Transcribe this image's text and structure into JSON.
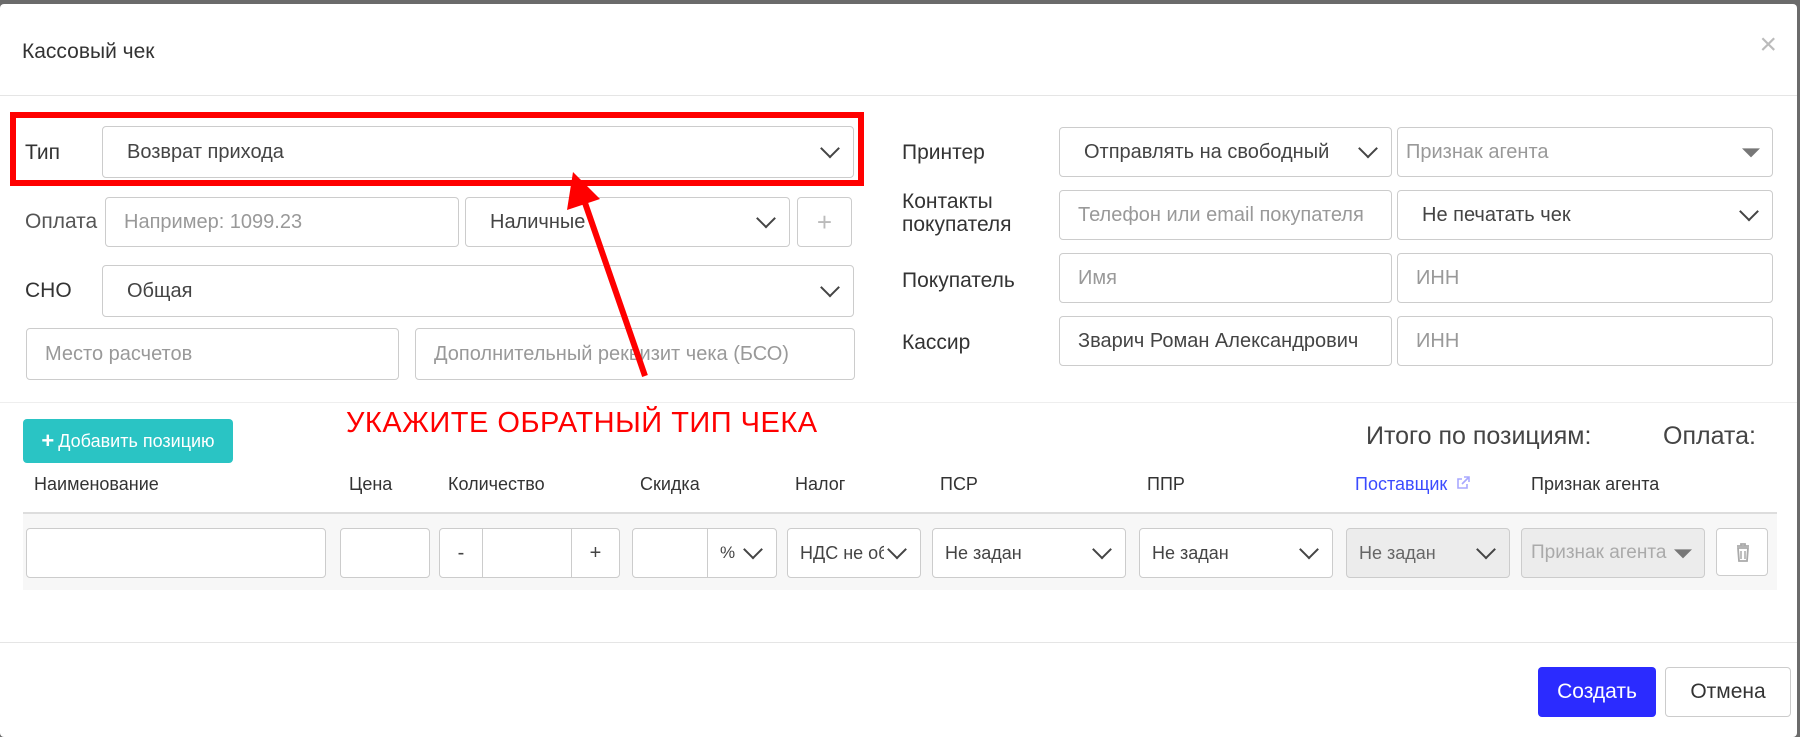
{
  "dialog": {
    "title": "Кассовый чек",
    "close_glyph": "×"
  },
  "form": {
    "type_label": "Тип",
    "type_value": "Возврат прихода",
    "payment_label": "Оплата",
    "payment_placeholder": "Например: 1099.23",
    "payment_method": "Наличные",
    "add_payment_glyph": "+",
    "sno_label": "СНО",
    "sno_value": "Общая",
    "place_placeholder": "Место расчетов",
    "extra_placeholder": "Дополнительный реквизит чека (БСО)",
    "printer_label": "Принтер",
    "printer_value": "Отправлять на свободный",
    "agent_placeholder": "Признак агента",
    "contacts_label_1": "Контакты",
    "contacts_label_2": "покупателя",
    "contacts_placeholder": "Телефон или email покупателя",
    "print_mode": "Не печатать чек",
    "buyer_label": "Покупатель",
    "buyer_name_placeholder": "Имя",
    "buyer_inn_placeholder": "ИНН",
    "cashier_label": "Кассир",
    "cashier_value": "Зварич Роман Александрович",
    "cashier_inn_placeholder": "ИНН"
  },
  "annotation": {
    "hint": "УКАЖИТЕ ОБРАТНЫЙ ТИП ЧЕКА",
    "color": "#ff0000"
  },
  "positions": {
    "add_label": "Добавить позицию",
    "totals_label": "Итого по позициям:",
    "payment_total_label": "Оплата:",
    "columns": [
      "Наименование",
      "Цена",
      "Количество",
      "Скидка",
      "Налог",
      "ПСР",
      "ППР",
      "Поставщик",
      "Признак агента"
    ],
    "row": {
      "minus": "-",
      "plus": "+",
      "discount_unit": "%",
      "tax": "НДС не об",
      "psr": "Не задан",
      "ppr": "Не задан",
      "supplier": "Не задан",
      "agent": "Признак агента"
    }
  },
  "footer": {
    "create_label": "Создать",
    "cancel_label": "Отмена"
  },
  "colors": {
    "accent": "#2b2bff",
    "teal": "#2ac4c4",
    "link": "#3b4bff"
  }
}
